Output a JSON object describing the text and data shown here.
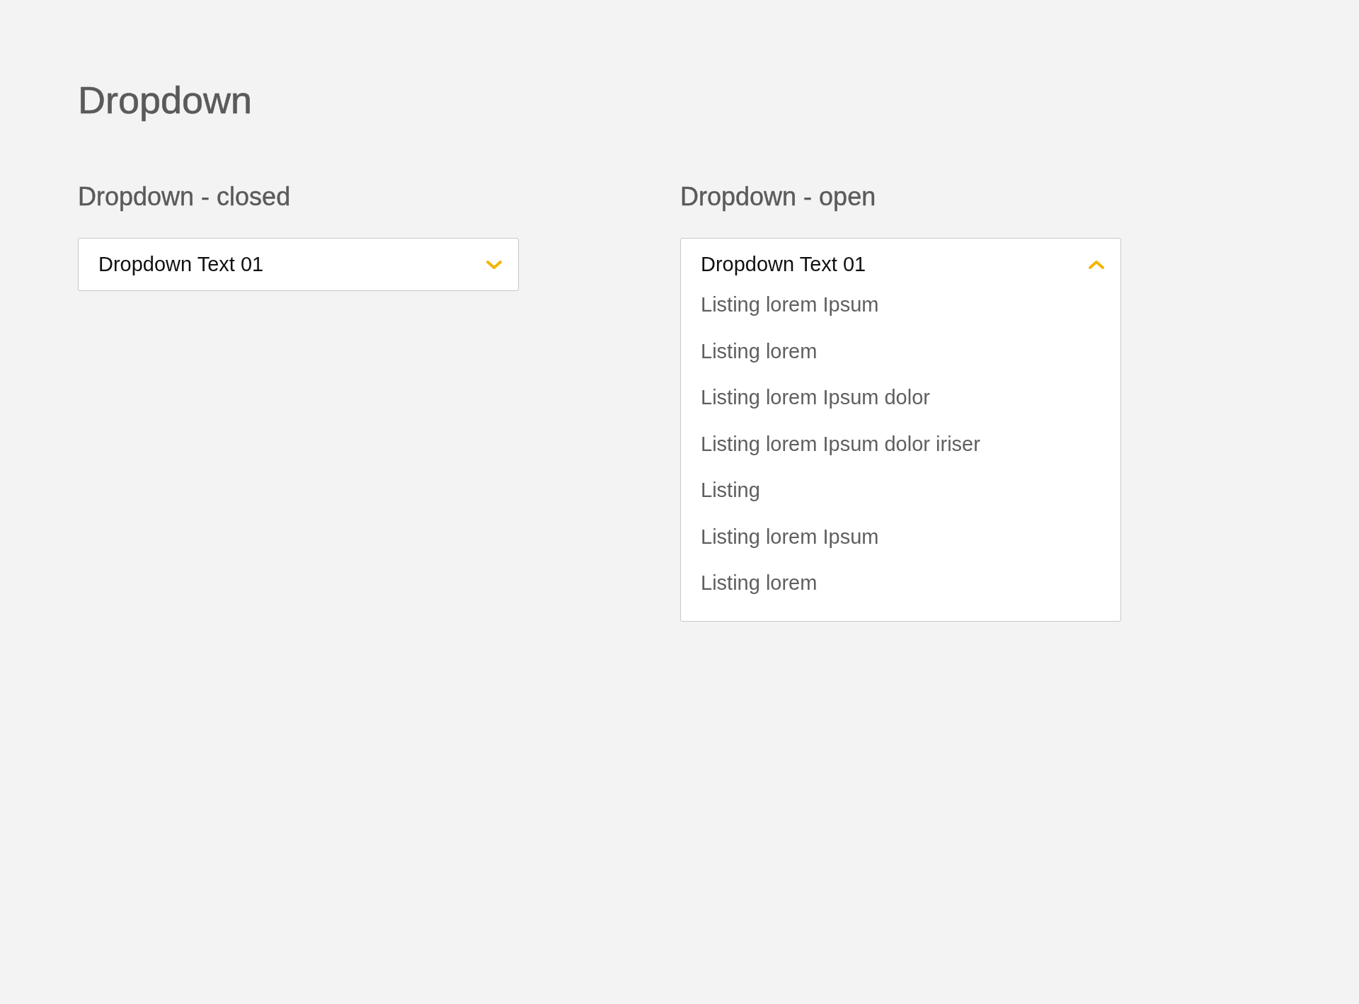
{
  "title": "Dropdown",
  "dropdowns": [
    {
      "heading": "Dropdown - closed",
      "value": "Dropdown Text 01",
      "expanded": false
    },
    {
      "heading": "Dropdown - open",
      "value": "Dropdown Text 01",
      "expanded": true,
      "options": [
        "Listing lorem Ipsum",
        "Listing lorem",
        "Listing lorem Ipsum dolor",
        "Listing lorem Ipsum dolor iriser",
        "Listing",
        "Listing lorem Ipsum",
        "Listing lorem"
      ]
    }
  ]
}
